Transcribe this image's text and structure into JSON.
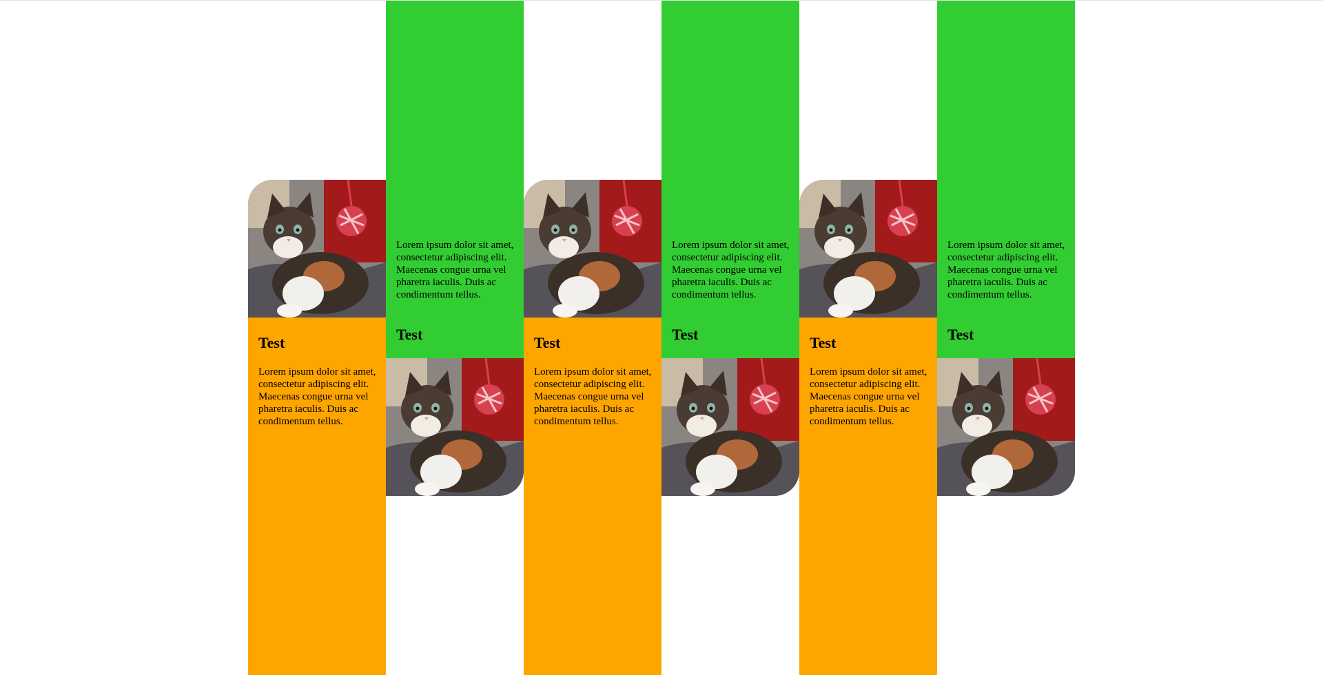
{
  "cards": [
    {
      "variant": "orange",
      "title": "Test",
      "text": "Lorem ipsum dolor sit amet, consectetur adipiscing elit. Maecenas congue urna vel pharetra iaculis. Duis ac condimentum tellus.",
      "image_alt": "kitten with red yarn ball"
    },
    {
      "variant": "green",
      "title": "Test",
      "text": "Lorem ipsum dolor sit amet, consectetur adipiscing elit. Maecenas congue urna vel pharetra iaculis. Duis ac condimentum tellus.",
      "image_alt": "kitten with red yarn ball"
    },
    {
      "variant": "orange",
      "title": "Test",
      "text": "Lorem ipsum dolor sit amet, consectetur adipiscing elit. Maecenas congue urna vel pharetra iaculis. Duis ac condimentum tellus.",
      "image_alt": "kitten with red yarn ball"
    },
    {
      "variant": "green",
      "title": "Test",
      "text": "Lorem ipsum dolor sit amet, consectetur adipiscing elit. Maecenas congue urna vel pharetra iaculis. Duis ac condimentum tellus.",
      "image_alt": "kitten with red yarn ball"
    },
    {
      "variant": "orange",
      "title": "Test",
      "text": "Lorem ipsum dolor sit amet, consectetur adipiscing elit. Maecenas congue urna vel pharetra iaculis. Duis ac condimentum tellus.",
      "image_alt": "kitten with red yarn ball"
    },
    {
      "variant": "green",
      "title": "Test",
      "text": "Lorem ipsum dolor sit amet, consectetur adipiscing elit. Maecenas congue urna vel pharetra iaculis. Duis ac condimentum tellus.",
      "image_alt": "kitten with red yarn ball"
    }
  ],
  "colors": {
    "orange": "#ffa500",
    "green": "#32cd32",
    "background": "#ffffff"
  }
}
